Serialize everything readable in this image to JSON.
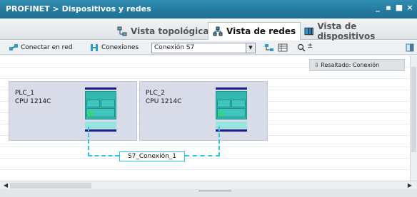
{
  "window": {
    "title": "PROFINET > Dispositivos y redes",
    "controls": [
      "_",
      "▪",
      "■",
      "×"
    ]
  },
  "tabs": [
    {
      "label": "Vista topológica",
      "icon": "topology-icon",
      "active": false
    },
    {
      "label": "Vista de redes",
      "icon": "network-icon",
      "active": true
    },
    {
      "label": "Vista de dispositivos",
      "icon": "device-icon",
      "active": false
    }
  ],
  "toolbar": {
    "connect_label": "Conectar en red",
    "connections_label": "Conexiones",
    "connection_type": "Conexión S7",
    "zoom_label": "±"
  },
  "canvas": {
    "highlight_label": "Resaltado: Conexión",
    "devices": [
      {
        "name": "PLC_1",
        "cpu": "CPU 1214C"
      },
      {
        "name": "PLC_2",
        "cpu": "CPU 1214C"
      }
    ],
    "connection_label": "S7_Conexión_1"
  },
  "colors": {
    "accent": "#2f8cb0",
    "connection": "#29c7e8",
    "module": "#33b8b0",
    "port": "#29e05a"
  }
}
